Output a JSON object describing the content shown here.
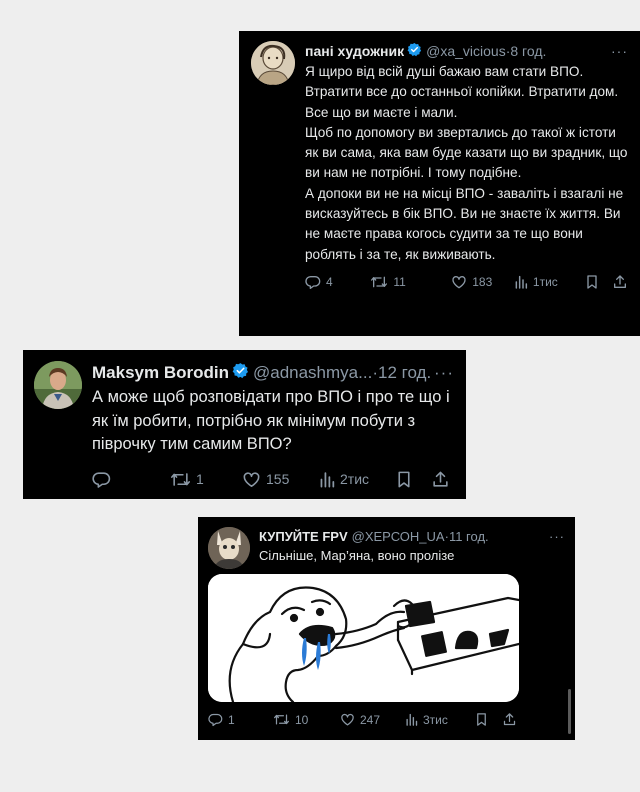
{
  "tweets": [
    {
      "name": "пані художник",
      "handle": "@xa_vicious",
      "dot": "·",
      "time": "8 год.",
      "more": "···",
      "text": "Я щиро від всій душі бажаю вам стати ВПО.\nВтратити все до останньої копійки. Втратити дом. Все що ви маєте і мали.\nЩоб по допомогу ви звертались до такої ж істоти як ви сама, яка вам буде казати що ви зрадник, що ви нам не потрібні. І тому подібне.\nА допоки ви не на місці ВПО - заваліть і взагалі не висказуйтесь в бік ВПО. Ви не знаєте їх життя. Ви не маєте права когось судити за те що вони роблять і за те, як виживають.",
      "replies": "4",
      "retweets": "11",
      "likes": "183",
      "views": "1тис"
    },
    {
      "name": "Maksym Borodin",
      "handle": "@adnashmya...",
      "dot": "·",
      "time": "12 год.",
      "more": "···",
      "text": "А може щоб розповідати про ВПО і про те що і як їм робити, потрібно як мінімум побути з піврочку тим самим ВПО?",
      "replies": "",
      "retweets": "1",
      "likes": "155",
      "views": "2тис"
    },
    {
      "name": "КУПУЙТЕ FPV",
      "handle": "@ХЕРСОН_UA",
      "dot": "·",
      "time": "11 год.",
      "more": "···",
      "text": "Сільніше, Мар’яна, воно пролізе",
      "replies": "1",
      "retweets": "10",
      "likes": "247",
      "views": "3тис"
    }
  ],
  "colors": {
    "background": "#eeeeee",
    "card": "#000000",
    "text": "#e7e9ea",
    "muted": "#8b98a5",
    "verified": "#1d9bf0",
    "meme_tears": "#2b7bd6"
  },
  "icons": [
    "verified-badge-icon",
    "reply-icon",
    "retweet-icon",
    "like-icon",
    "views-icon",
    "bookmark-icon",
    "share-icon"
  ]
}
